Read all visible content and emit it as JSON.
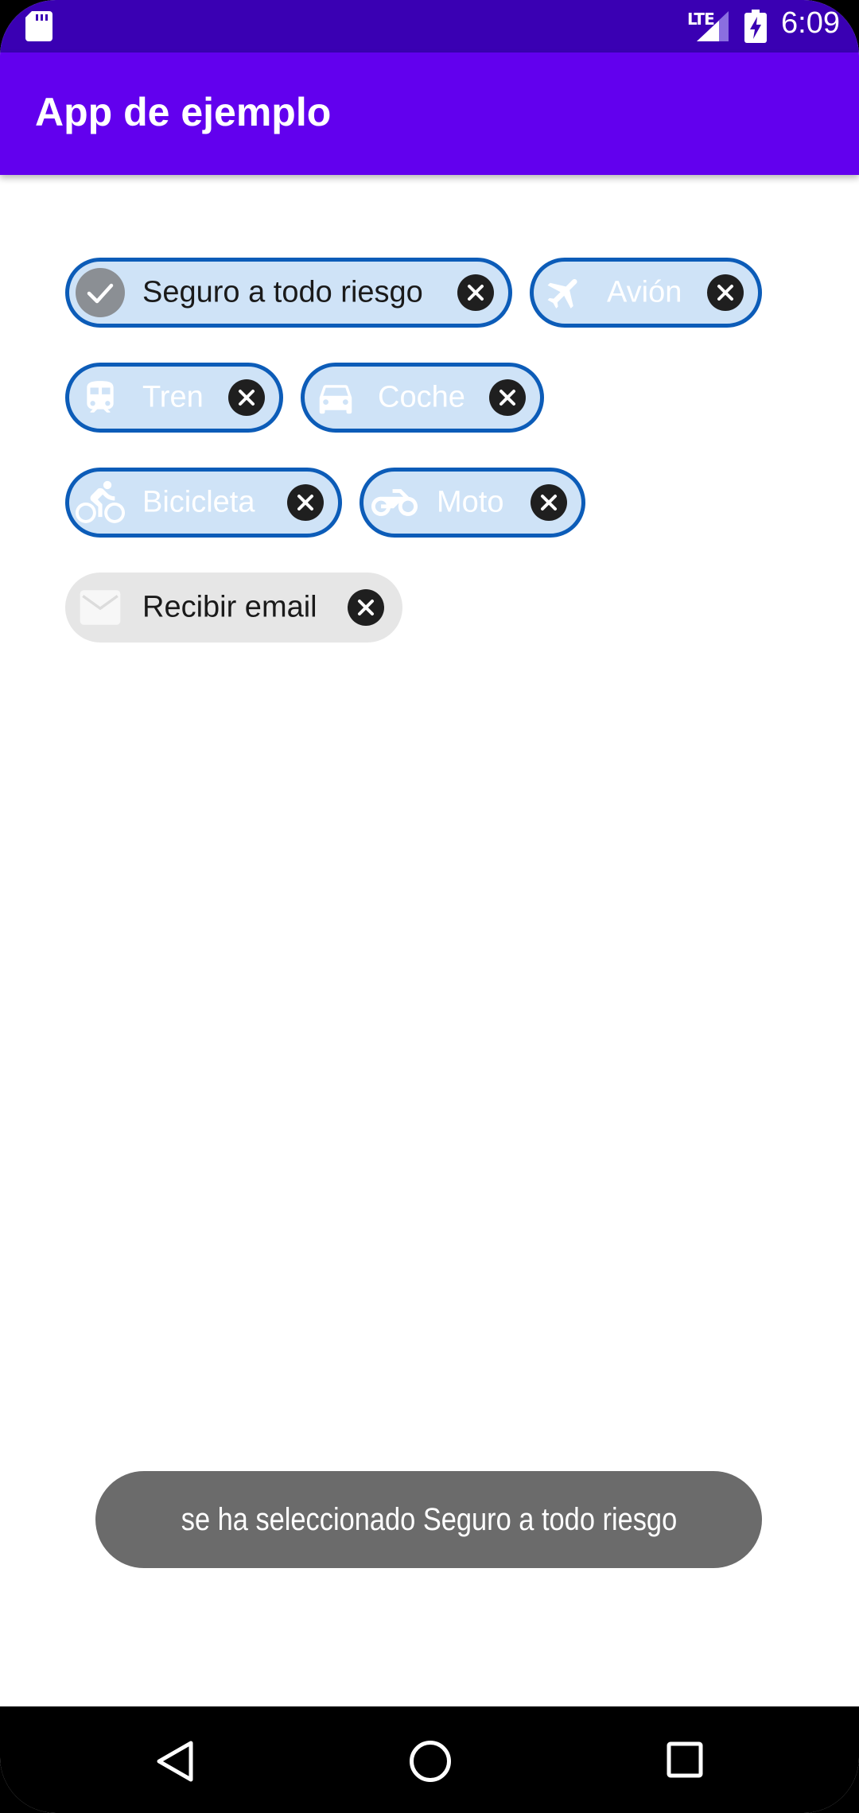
{
  "status_bar": {
    "network": "LTE",
    "time": "6:09"
  },
  "app_bar": {
    "title": "App de ejemplo"
  },
  "chips": [
    {
      "label": "Seguro a todo riesgo",
      "icon": "check-icon",
      "selected": true
    },
    {
      "label": "Avión",
      "icon": "airplane-icon"
    },
    {
      "label": "Tren",
      "icon": "train-icon"
    },
    {
      "label": "Coche",
      "icon": "car-icon"
    },
    {
      "label": "Bicicleta",
      "icon": "bicycle-icon"
    },
    {
      "label": "Moto",
      "icon": "motorcycle-icon"
    },
    {
      "label": "Recibir email",
      "icon": "email-icon"
    }
  ],
  "toast": {
    "message": "se ha seleccionado Seguro a todo riesgo"
  },
  "nav": {
    "back_icon": "back-icon",
    "home_icon": "home-icon",
    "recents_icon": "recents-icon"
  },
  "colors": {
    "status_bar": "#3a00b3",
    "app_bar": "#6200ee",
    "chip_background": "#cfe3f7",
    "chip_border": "#0c5cb8",
    "chip_plain_background": "#e6e6e6",
    "toast_background": "#6b6b6b"
  }
}
